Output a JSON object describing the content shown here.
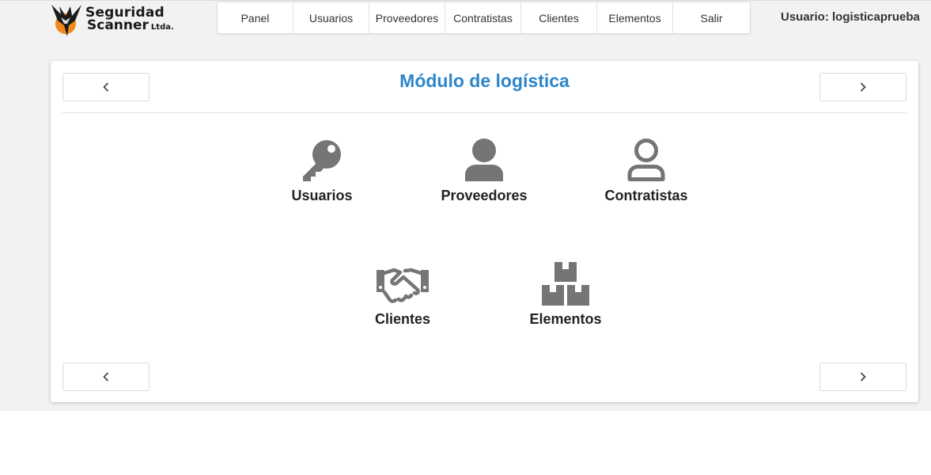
{
  "brand": {
    "line1": "Seguridad",
    "line2": "Scanner",
    "suffix": "Ltda.",
    "logo_icon": "eagle-logo-icon"
  },
  "nav": {
    "items": [
      {
        "label": "Panel"
      },
      {
        "label": "Usuarios"
      },
      {
        "label": "Proveedores"
      },
      {
        "label": "Contratistas"
      },
      {
        "label": "Clientes"
      },
      {
        "label": "Elementos"
      },
      {
        "label": "Salir"
      }
    ]
  },
  "user": {
    "label": "Usuario: logisticaprueba"
  },
  "main": {
    "title": "Módulo de logística",
    "prev_icon": "chevron-left-icon",
    "next_icon": "chevron-right-icon",
    "modules": [
      {
        "label": "Usuarios",
        "icon": "key-icon"
      },
      {
        "label": "Proveedores",
        "icon": "user-solid-icon"
      },
      {
        "label": "Contratistas",
        "icon": "user-outline-icon"
      },
      {
        "label": "Clientes",
        "icon": "handshake-icon"
      },
      {
        "label": "Elementos",
        "icon": "boxes-icon"
      }
    ]
  },
  "colors": {
    "accent": "#2e86c9",
    "icon": "#757575",
    "background": "#f2f2f2"
  }
}
